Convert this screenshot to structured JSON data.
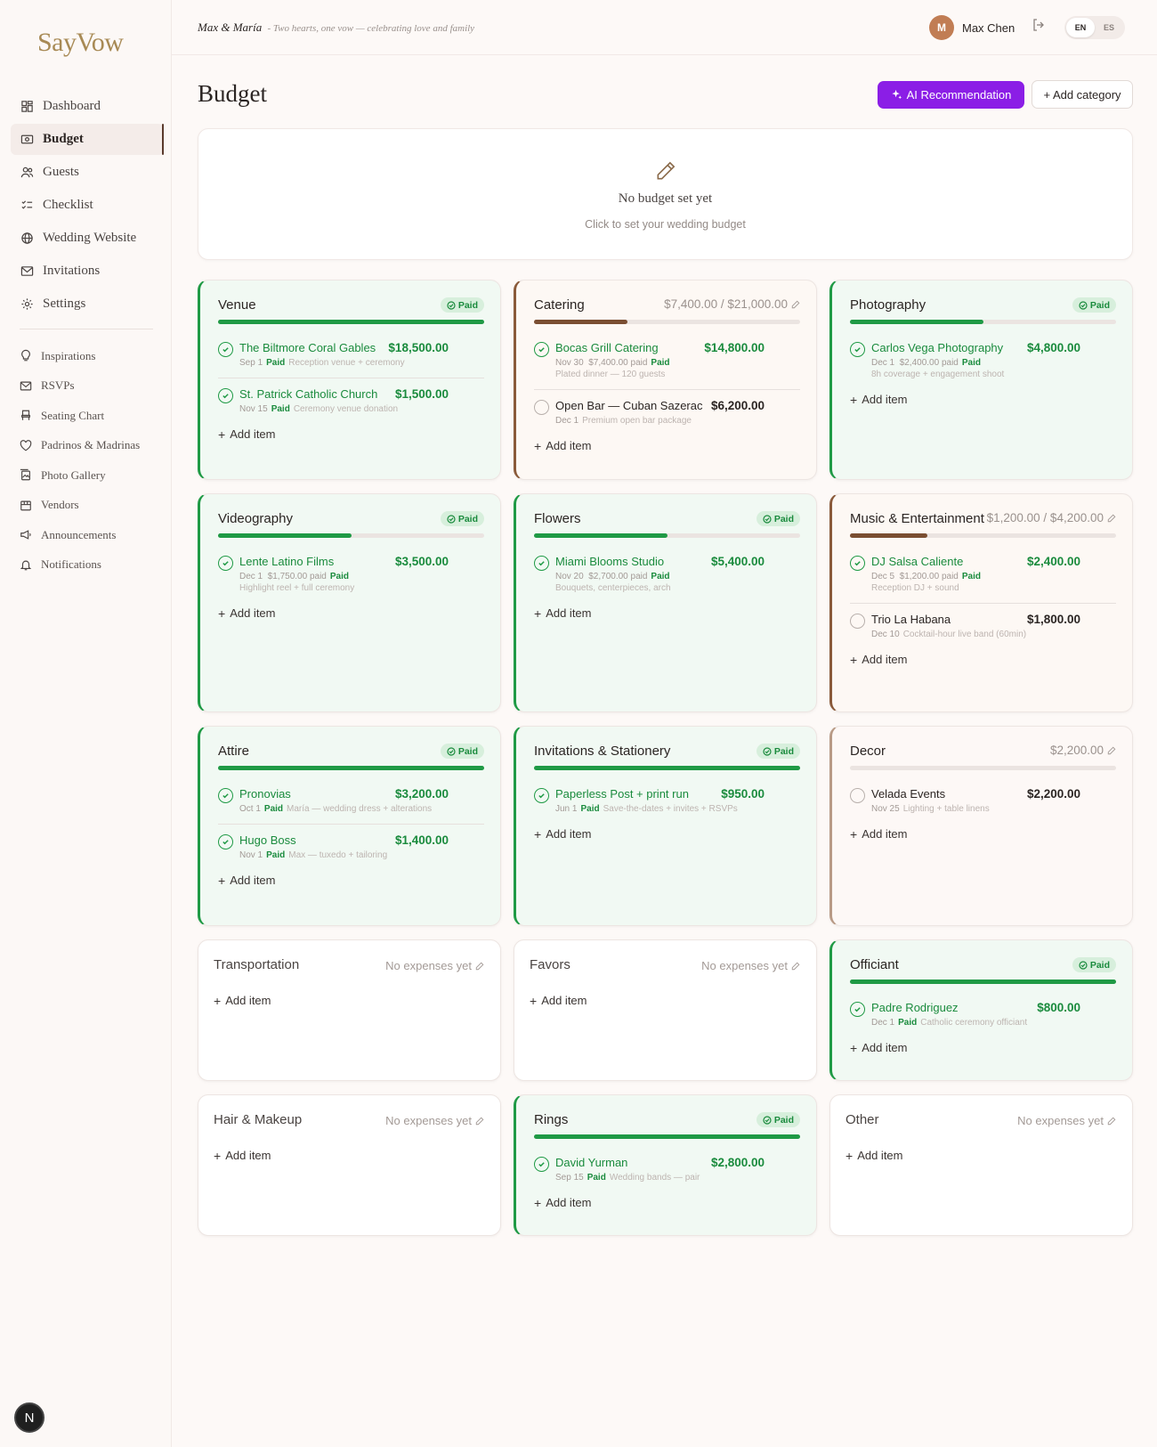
{
  "brand": "SayVow",
  "sidebar": {
    "main": [
      {
        "label": "Dashboard",
        "icon": "dashboard-icon"
      },
      {
        "label": "Budget",
        "icon": "budget-icon",
        "active": true
      },
      {
        "label": "Guests",
        "icon": "guests-icon"
      },
      {
        "label": "Checklist",
        "icon": "checklist-icon"
      },
      {
        "label": "Wedding Website",
        "icon": "globe-icon"
      },
      {
        "label": "Invitations",
        "icon": "mail-icon"
      },
      {
        "label": "Settings",
        "icon": "gear-icon"
      }
    ],
    "secondary": [
      {
        "label": "Inspirations",
        "icon": "bulb-icon"
      },
      {
        "label": "RSVPs",
        "icon": "mail-icon"
      },
      {
        "label": "Seating Chart",
        "icon": "chair-icon"
      },
      {
        "label": "Padrinos & Madrinas",
        "icon": "heart-icon"
      },
      {
        "label": "Photo Gallery",
        "icon": "gallery-icon"
      },
      {
        "label": "Vendors",
        "icon": "store-icon"
      },
      {
        "label": "Announcements",
        "icon": "megaphone-icon"
      },
      {
        "label": "Notifications",
        "icon": "bell-icon"
      }
    ]
  },
  "header": {
    "couple": "Max & María",
    "tagline": "- Two hearts, one vow — celebrating love and family",
    "avatar_initial": "M",
    "user_name": "Max Chen",
    "lang": {
      "en": "EN",
      "es": "ES",
      "active": "EN"
    }
  },
  "page": {
    "title": "Budget",
    "ai_button": "AI Recommendation",
    "add_category": "+ Add category",
    "budget_empty_title": "No budget set yet",
    "budget_empty_sub": "Click to set your wedding budget"
  },
  "add_item_label": "Add item",
  "paid_label": "Paid",
  "no_expenses_label": "No expenses yet",
  "categories": [
    {
      "title": "Venue",
      "status": "paid",
      "progress": 1.0,
      "items": [
        {
          "name": "The Biltmore Coral Gables",
          "amount": "$18,500.00",
          "date": "Sep 1",
          "paid_amt": "",
          "paid": true,
          "note": "Reception venue + ceremony"
        },
        {
          "name": "St. Patrick Catholic Church",
          "amount": "$1,500.00",
          "date": "Nov 15",
          "paid_amt": "",
          "paid": true,
          "note": "Ceremony venue donation"
        }
      ]
    },
    {
      "title": "Catering",
      "status": "partial",
      "progress": 0.35,
      "spent": "$7,400.00 / $21,000.00",
      "items": [
        {
          "name": "Bocas Grill Catering",
          "amount": "$14,800.00",
          "date": "Nov 30",
          "paid_amt": "$7,400.00 paid",
          "paid": true,
          "note": "Plated dinner — 120 guests"
        },
        {
          "name": "Open Bar — Cuban Sazerac",
          "amount": "$6,200.00",
          "date": "Dec 1",
          "paid_amt": "",
          "paid": false,
          "note": "Premium open bar package"
        }
      ]
    },
    {
      "title": "Photography",
      "status": "paid",
      "progress": 0.5,
      "items": [
        {
          "name": "Carlos Vega Photography",
          "amount": "$4,800.00",
          "date": "Dec 1",
          "paid_amt": "$2,400.00 paid",
          "paid": true,
          "note": "8h coverage + engagement shoot"
        }
      ]
    },
    {
      "title": "Videography",
      "status": "paid",
      "progress": 0.5,
      "items": [
        {
          "name": "Lente Latino Films",
          "amount": "$3,500.00",
          "date": "Dec 1",
          "paid_amt": "$1,750.00 paid",
          "paid": true,
          "note": "Highlight reel + full ceremony"
        }
      ]
    },
    {
      "title": "Flowers",
      "status": "paid",
      "progress": 0.5,
      "items": [
        {
          "name": "Miami Blooms Studio",
          "amount": "$5,400.00",
          "date": "Nov 20",
          "paid_amt": "$2,700.00 paid",
          "paid": true,
          "note": "Bouquets, centerpieces, arch"
        }
      ]
    },
    {
      "title": "Music & Entertainment",
      "status": "partial",
      "progress": 0.29,
      "spent": "$1,200.00 / $4,200.00",
      "items": [
        {
          "name": "DJ Salsa Caliente",
          "amount": "$2,400.00",
          "date": "Dec 5",
          "paid_amt": "$1,200.00 paid",
          "paid": true,
          "note": "Reception DJ + sound"
        },
        {
          "name": "Trio La Habana",
          "amount": "$1,800.00",
          "date": "Dec 10",
          "paid_amt": "",
          "paid": false,
          "note": "Cocktail-hour live band (60min)"
        }
      ]
    },
    {
      "title": "Attire",
      "status": "paid",
      "progress": 1.0,
      "items": [
        {
          "name": "Pronovias",
          "amount": "$3,200.00",
          "date": "Oct 1",
          "paid_amt": "",
          "paid": true,
          "note": "María — wedding dress + alterations"
        },
        {
          "name": "Hugo Boss",
          "amount": "$1,400.00",
          "date": "Nov 1",
          "paid_amt": "",
          "paid": true,
          "note": "Max — tuxedo + tailoring"
        }
      ]
    },
    {
      "title": "Invitations & Stationery",
      "status": "paid",
      "progress": 1.0,
      "items": [
        {
          "name": "Paperless Post + print run",
          "amount": "$950.00",
          "date": "Jun 1",
          "paid_amt": "",
          "paid": true,
          "note": "Save-the-dates + invites + RSVPs"
        }
      ]
    },
    {
      "title": "Decor",
      "status": "unpaid",
      "progress": 0,
      "spent": "$2,200.00",
      "items": [
        {
          "name": "Velada Events",
          "amount": "$2,200.00",
          "date": "Nov 25",
          "paid_amt": "",
          "paid": false,
          "note": "Lighting + table linens"
        }
      ]
    },
    {
      "title": "Transportation",
      "status": "empty",
      "items": []
    },
    {
      "title": "Favors",
      "status": "empty",
      "items": []
    },
    {
      "title": "Officiant",
      "status": "paid",
      "progress": 1.0,
      "items": [
        {
          "name": "Padre Rodriguez",
          "amount": "$800.00",
          "date": "Dec 1",
          "paid_amt": "",
          "paid": true,
          "note": "Catholic ceremony officiant"
        }
      ]
    },
    {
      "title": "Hair & Makeup",
      "status": "empty",
      "items": []
    },
    {
      "title": "Rings",
      "status": "paid",
      "progress": 1.0,
      "items": [
        {
          "name": "David Yurman",
          "amount": "$2,800.00",
          "date": "Sep 15",
          "paid_amt": "",
          "paid": true,
          "note": "Wedding bands — pair"
        }
      ]
    },
    {
      "title": "Other",
      "status": "empty",
      "items": []
    }
  ]
}
